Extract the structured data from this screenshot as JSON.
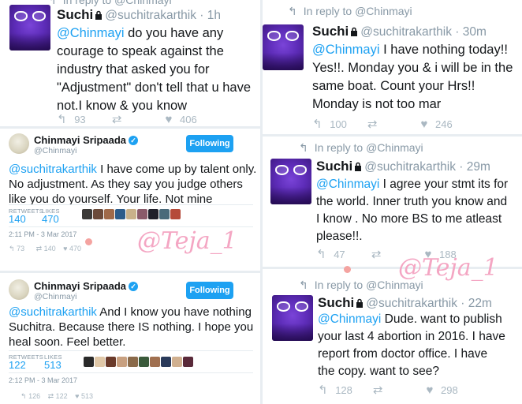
{
  "left_top_tweet": {
    "reply_prefix": "In reply to @Chinmayi",
    "name": "Suchi",
    "handle_time": "@suchitrakarthik · 1h",
    "mention": "@Chinmayi",
    "text_lines": [
      "do you have any",
      "courage to speak against the",
      "industry that asked you for",
      "\"Adjustment\" don't tell that u have",
      "not.I know & you know"
    ],
    "retweets": "",
    "replies": "93",
    "likes": "406"
  },
  "card1": {
    "name": "Chinmayi Sripaada",
    "handle": "@Chinmayi",
    "follow_label": "Following",
    "mention": "@suchitrakarthik",
    "text_lines": [
      "I have come up by talent only.",
      "No adjustment. As they say you judge others",
      "like you do yourself. Your life. Not mine"
    ],
    "retweets_label": "RETWEETS",
    "likes_label": "LIKES",
    "retweets": "140",
    "likes": "470",
    "timestamp": "2:11 PM - 3 Mar 2017",
    "act_replies": "73",
    "act_retweets": "140",
    "act_likes": "470"
  },
  "card2": {
    "name": "Chinmayi Sripaada",
    "handle": "@Chinmayi",
    "follow_label": "Following",
    "mention": "@suchitrakarthik",
    "text_lines": [
      "And I know you have nothing",
      "Suchitra. Because there IS nothing. I hope you",
      "heal soon. Feel better."
    ],
    "retweets_label": "RETWEETS",
    "likes_label": "LIKES",
    "retweets": "122",
    "likes": "513",
    "timestamp": "2:12 PM - 3 Mar 2017",
    "act_replies": "126",
    "act_retweets": "122",
    "act_likes": "513"
  },
  "right_tweet1": {
    "reply_prefix": "In reply to @Chinmayi",
    "name": "Suchi",
    "handle_time": "@suchitrakarthik · 30m",
    "mention": "@Chinmayi",
    "text_lines": [
      "I have nothing today!!",
      "Yes!!. Monday you & i will be in the",
      "same boat. Count your Hrs!!",
      "Monday is not too mar"
    ],
    "replies": "100",
    "likes": "246"
  },
  "right_tweet2": {
    "reply_prefix": "In reply to @Chinmayi",
    "name": "Suchi",
    "handle_time": "@suchitrakarthik · 29m",
    "mention": "@Chinmayi",
    "text_lines": [
      "I agree your stmt its for",
      "the world. Inner truth you know and",
      "I know . No more BS to me atleast",
      "please!!."
    ],
    "replies": "47",
    "likes": "188"
  },
  "right_tweet3": {
    "reply_prefix": "In reply to @Chinmayi",
    "name": "Suchi",
    "handle_time": "@suchitrakarthik · 22m",
    "mention": "@Chinmayi",
    "text_lines": [
      "Dude. want to publish",
      "your last 4 abortion in 2016. I have",
      "report  from doctor office. I have",
      "the copy. want to see?"
    ],
    "replies": "128",
    "likes": "298"
  },
  "watermarks": [
    "@Teja_1",
    "@Teja_1"
  ],
  "colors": {
    "link": "#1da1f2",
    "muted": "#8899a6",
    "watermark": "#f4a6c3"
  }
}
